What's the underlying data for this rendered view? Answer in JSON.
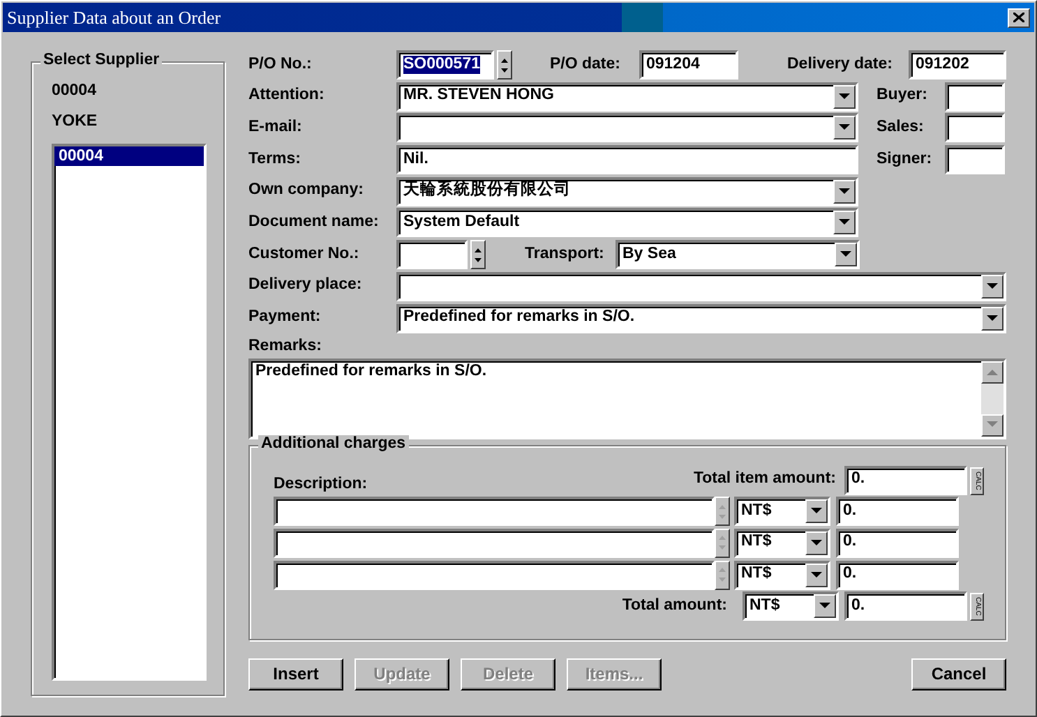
{
  "window": {
    "title": "Supplier Data about an Order"
  },
  "supplier": {
    "title": "Select Supplier",
    "code": "00004",
    "name": "YOKE",
    "list": [
      {
        "label": "00004",
        "selected": true
      }
    ]
  },
  "header": {
    "po_no": {
      "label": "P/O No.:",
      "value": "SO000571",
      "selected": true
    },
    "po_date": {
      "label": "P/O date:",
      "value": "091204"
    },
    "delivery_date": {
      "label": "Delivery date:",
      "value": "091202"
    }
  },
  "rows": [
    {
      "kind": "combo",
      "label": "Attention:",
      "value": "MR. STEVEN HONG"
    },
    {
      "kind": "combo",
      "label": "E-mail:"
    },
    {
      "kind": "text",
      "label": "Terms:",
      "value": "Nil."
    },
    {
      "kind": "combo",
      "label": "Own company:",
      "value": "天輪系統股份有限公司"
    },
    {
      "kind": "combo",
      "label": "Document name:",
      "value": "System Default"
    }
  ],
  "side_fields": [
    {
      "label": "Buyer:"
    },
    {
      "label": "Sales:"
    },
    {
      "label": "Signer:"
    }
  ],
  "customer": {
    "label": "Customer No.:"
  },
  "transport": {
    "label": "Transport:",
    "value": "By Sea"
  },
  "delivery_place": {
    "label": "Delivery place:"
  },
  "payment": {
    "label": "Payment:",
    "value": "Predefined for remarks in S/O."
  },
  "remarks": {
    "label": "Remarks:",
    "value": "Predefined for remarks in S/O."
  },
  "charges": {
    "title": "Additional charges",
    "description_label": "Description:",
    "total_item_label": "Total item amount:",
    "total_item_value": "0.",
    "total_item_calc": "CALC",
    "lines": [
      {
        "currency": "NT$",
        "amount": "0."
      },
      {
        "currency": "NT$",
        "amount": "0."
      },
      {
        "currency": "NT$",
        "amount": "0."
      }
    ],
    "total_label": "Total amount:",
    "total_currency": "NT$",
    "total_value": "0.",
    "total_calc": "CALC"
  },
  "buttons": [
    {
      "label": "Insert",
      "disabled": false
    },
    {
      "label": "Update",
      "disabled": true
    },
    {
      "label": "Delete",
      "disabled": true
    },
    {
      "label": "Items...",
      "disabled": true
    },
    {
      "label": "Cancel",
      "disabled": false
    }
  ]
}
